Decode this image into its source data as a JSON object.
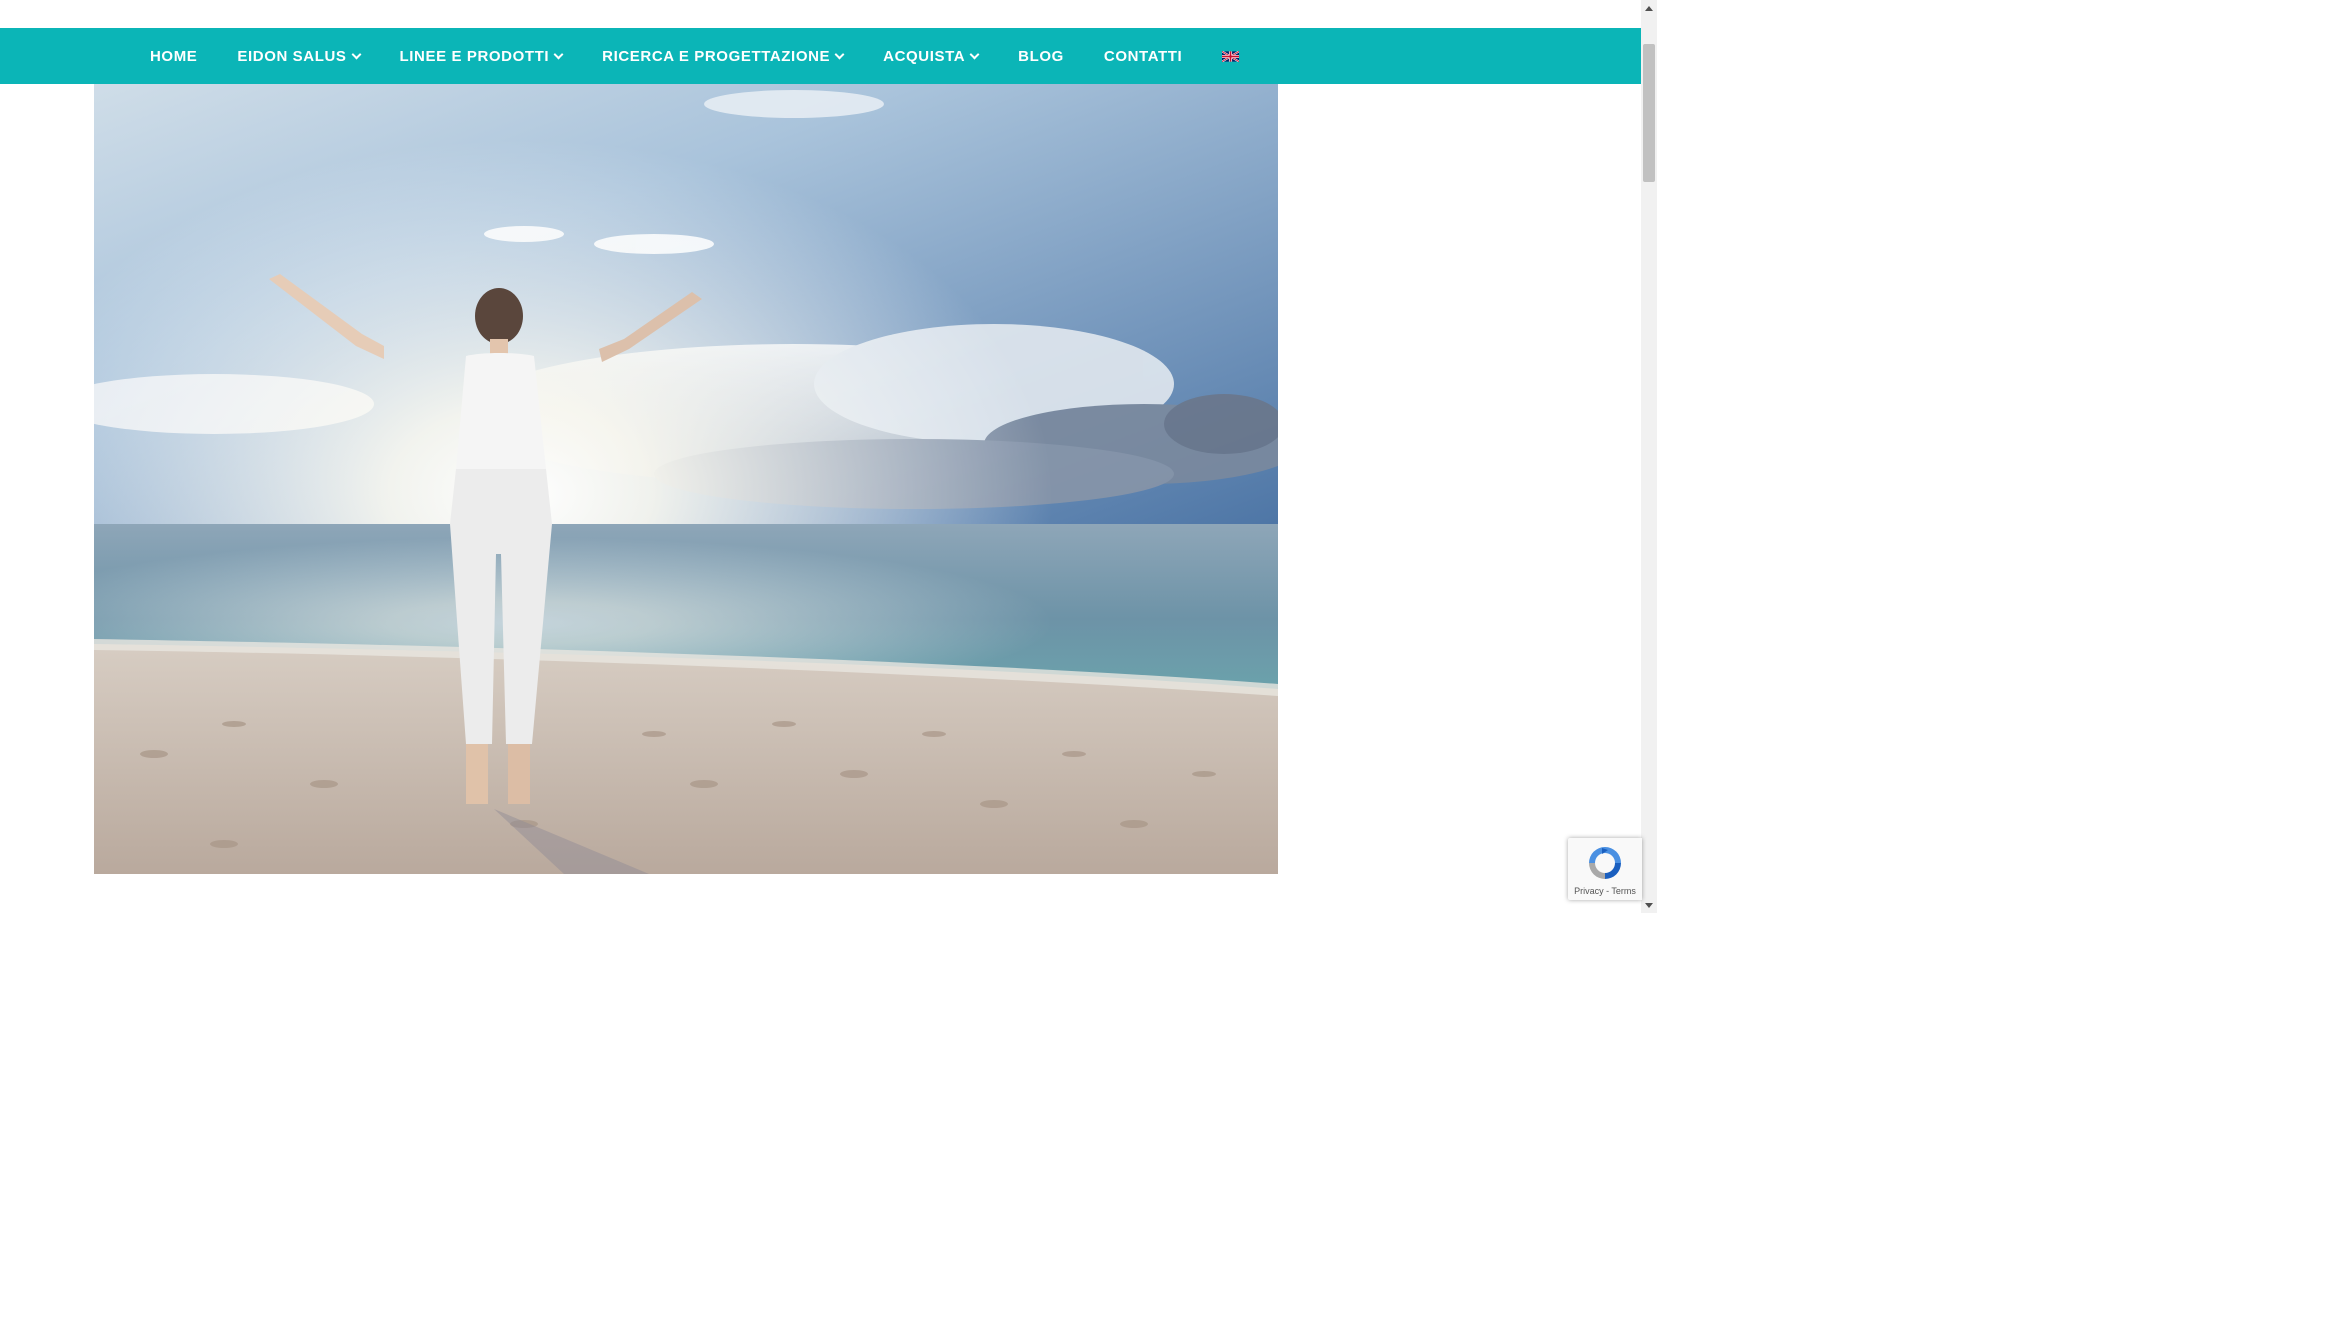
{
  "nav": {
    "items": [
      {
        "label": "HOME",
        "dropdown": false
      },
      {
        "label": "EIDON SALUS",
        "dropdown": true
      },
      {
        "label": "LINEE E PRODOTTI",
        "dropdown": true
      },
      {
        "label": "RICERCA E PROGETTAZIONE",
        "dropdown": true
      },
      {
        "label": "ACQUISTA",
        "dropdown": true
      },
      {
        "label": "BLOG",
        "dropdown": false
      },
      {
        "label": "CONTATTI",
        "dropdown": false
      }
    ],
    "language_flag": "uk-flag-icon"
  },
  "colors": {
    "nav_background": "#0bb5b7",
    "nav_text": "#ffffff"
  },
  "recaptcha": {
    "links": "Privacy - Terms"
  }
}
